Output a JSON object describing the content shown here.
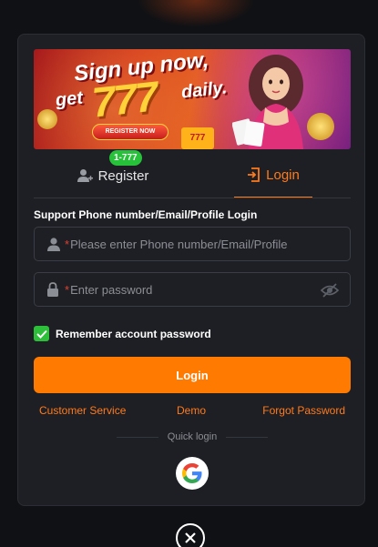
{
  "banner": {
    "headline": "Sign up now,",
    "get": "get",
    "amount": "777",
    "daily": "daily.",
    "register_cta": "REGISTER NOW",
    "slot": "777"
  },
  "tabs": {
    "register_label": "Register",
    "register_badge": "1-777",
    "login_label": "Login"
  },
  "form": {
    "label": "Support Phone number/Email/Profile Login",
    "phone_placeholder": "Please enter Phone number/Email/Profile",
    "password_placeholder": "Enter password",
    "required_mark": "*",
    "remember_label": "Remember account password",
    "remember_checked": true,
    "login_button": "Login"
  },
  "links": {
    "customer_service": "Customer Service",
    "demo": "Demo",
    "forgot_password": "Forgot Password"
  },
  "quick_login": {
    "label": "Quick login",
    "google_icon": "google-icon"
  },
  "colors": {
    "accent": "#ff7a00",
    "badge": "#27c23a",
    "required": "#e0412f",
    "background": "#1e1f24"
  }
}
